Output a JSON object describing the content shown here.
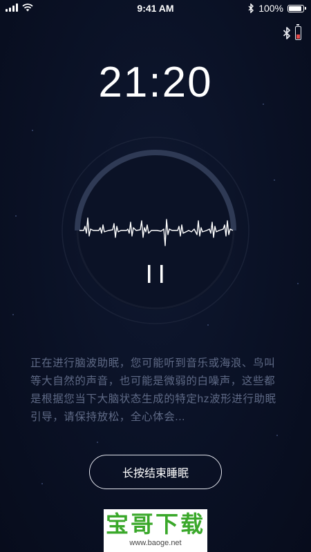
{
  "status_bar": {
    "time": "9:41 AM",
    "battery_percent": "100%",
    "battery_level": 1.0,
    "signal_icon": "signal-icon",
    "wifi_icon": "wifi-icon",
    "bluetooth_icon": "bluetooth-icon"
  },
  "device": {
    "bluetooth_icon": "bluetooth-icon",
    "battery_icon": "battery-low-icon"
  },
  "timer": {
    "value": "21:20"
  },
  "player": {
    "progress": 0.5,
    "pause_icon": "pause-icon"
  },
  "description": "正在进行脑波助眠，您可能听到音乐或海浪、鸟叫等大自然的声音，也可能是微弱的白噪声，这些都是根据您当下大脑状态生成的特定hz波形进行助眠引导，请保持放松，全心体会...",
  "end_button": {
    "label": "长按结束睡眠"
  },
  "watermark": {
    "title": "宝哥下载",
    "url": "www.baoge.net"
  },
  "colors": {
    "background": "#0a1125",
    "text_muted": "#5f6a86",
    "ring_track": "#2a3249",
    "ring_progress": "#3b455f",
    "battery_low": "#e84a4a",
    "watermark_green": "#3aa82a"
  }
}
